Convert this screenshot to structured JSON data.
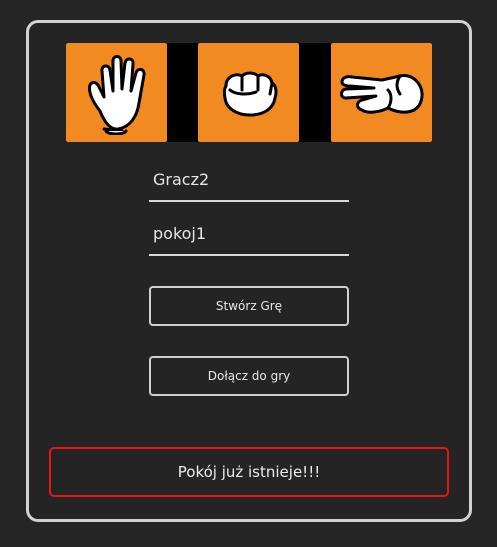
{
  "icons": [
    {
      "name": "paper-hand-icon",
      "color": "#f28a22"
    },
    {
      "name": "rock-fist-icon",
      "color": "#f28a22"
    },
    {
      "name": "scissors-hand-icon",
      "color": "#f28a22"
    }
  ],
  "form": {
    "player_name": "Gracz2",
    "room_name": "pokoj1"
  },
  "buttons": {
    "create": "Stwórz Grę",
    "join": "Dołącz do gry"
  },
  "alert": {
    "message": "Pokój już istnieje!!!",
    "border_color": "#e8141c"
  }
}
